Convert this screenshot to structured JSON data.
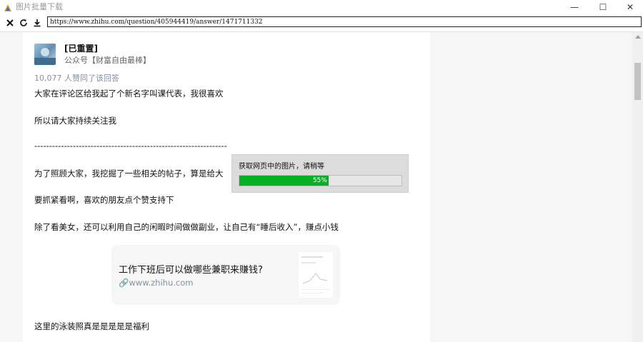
{
  "window": {
    "title": "图片批量下载",
    "min_glyph": "—",
    "max_glyph": "☐",
    "close_glyph": "✕"
  },
  "toolbar": {
    "url": "https://www.zhihu.com/question/405944419/answer/1471711332",
    "icons": [
      "stop-icon",
      "refresh-icon",
      "download-icon"
    ]
  },
  "answer": {
    "author_name": "[已重置]",
    "author_bio": "公众号【财富自由最棒】",
    "votes": "10,077 人赞同了该回答",
    "paragraphs": [
      "大家在评论区给我起了个新名字叫课代表，我很喜欢",
      "所以请大家持续关注我",
      "-----------------------------------------------------------------",
      "为了照顾大家，我挖掘了一些相关的帖子，算是给大",
      "要抓紧看啊，喜欢的朋友点个赞支持下",
      "除了看美女，还可以利用自己的闲暇时间做做副业，让自己有“睡后收入”，赚点小钱",
      "这里的泳装照真是是是是是福利"
    ],
    "link_card": {
      "title": "工作下班后可以做哪些兼职来赚钱?",
      "url": "www.zhihu.com"
    }
  },
  "dialog": {
    "message": "获取网页中的图片，请稍等",
    "progress_label": "55%",
    "progress": 0.55
  },
  "colors": {
    "progress_fill": "#06b025",
    "meta_text": "#8590a6",
    "card_bg": "#f6f6f6"
  }
}
